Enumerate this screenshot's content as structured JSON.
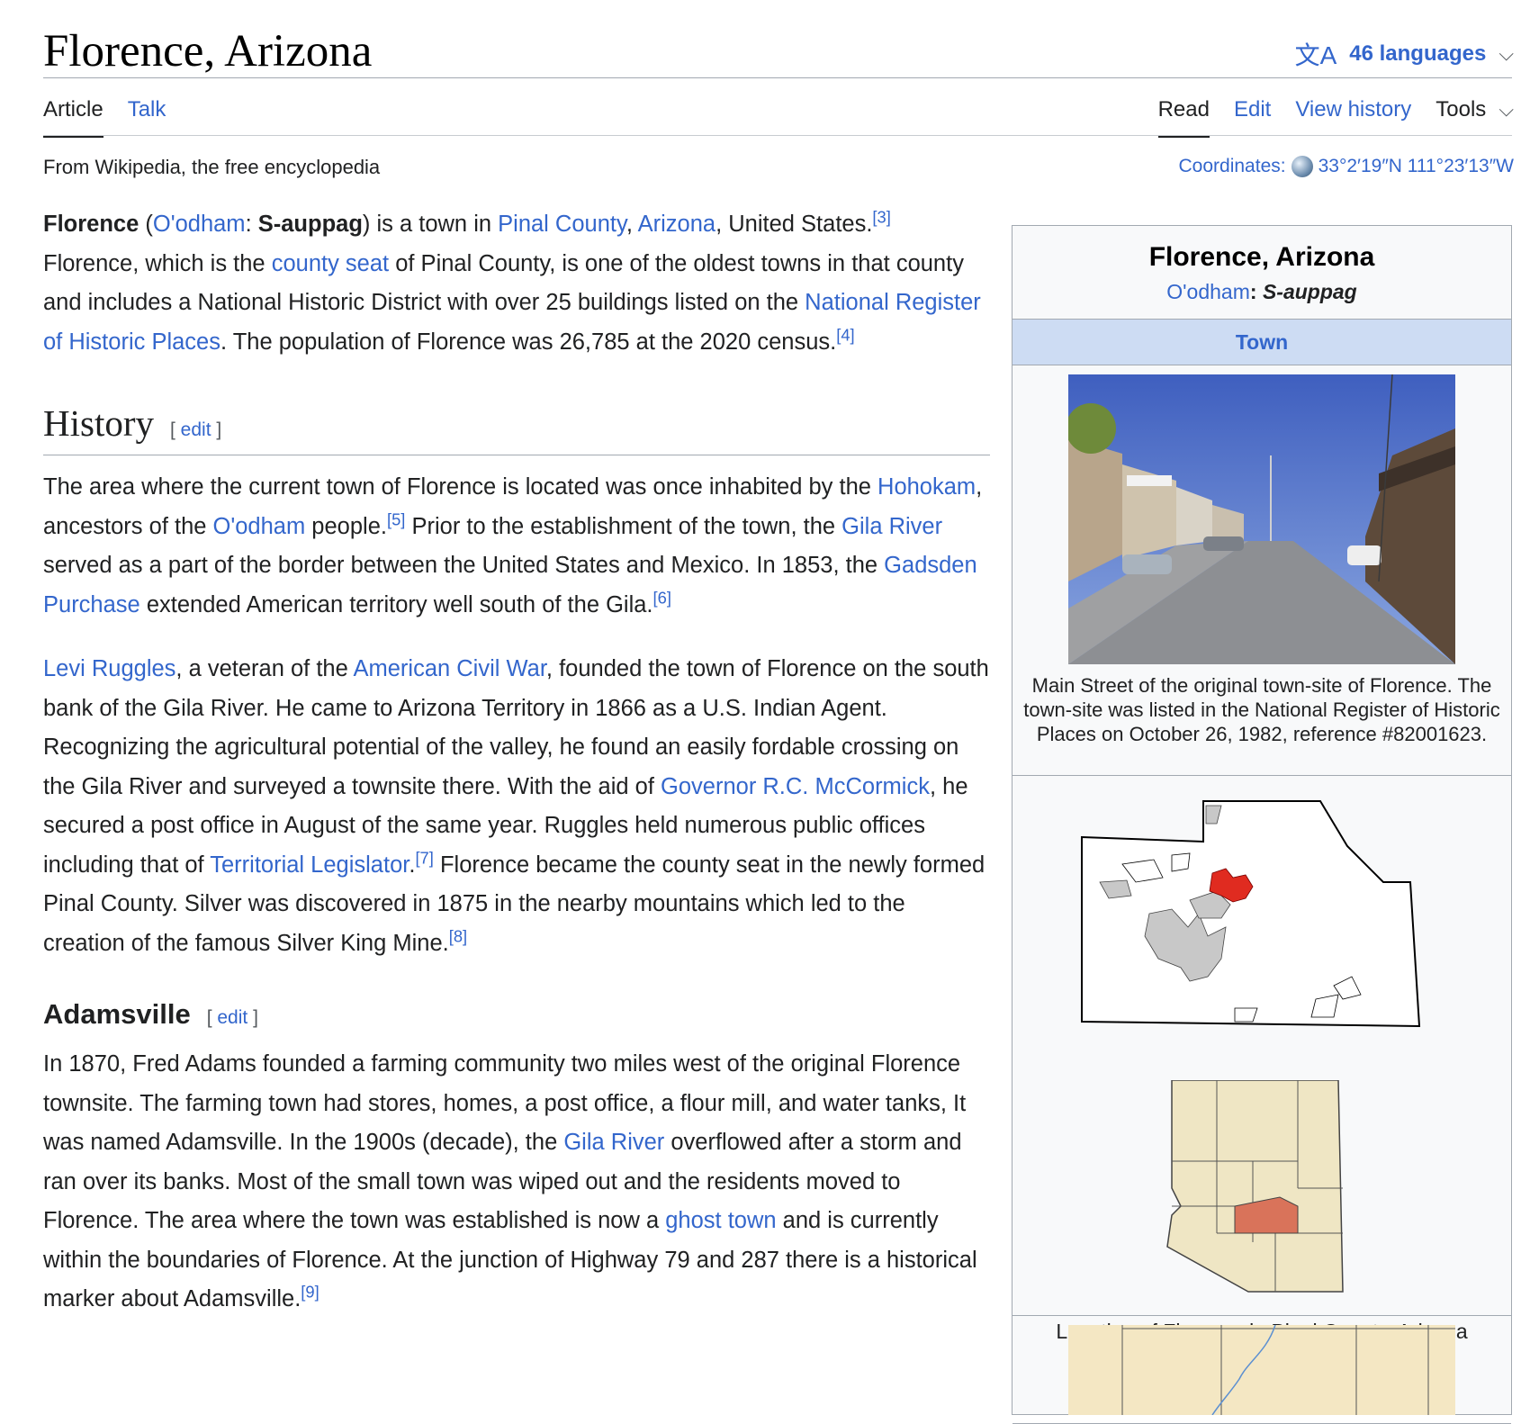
{
  "page": {
    "title": "Florence, Arizona",
    "languages_label": "46 languages",
    "tabs_left": [
      "Article",
      "Talk"
    ],
    "tabs_right": [
      "Read",
      "Edit",
      "View history",
      "Tools"
    ],
    "tagline": "From Wikipedia, the free encyclopedia",
    "coords_label": "Coordinates:",
    "coords_value": "33°2′19″N 111°23′13″W"
  },
  "intro": {
    "name": "Florence",
    "paren_open": " (",
    "oodham_link": "O'odham",
    "colon": ": ",
    "native_name": "S-auppag",
    "t1": ") is a town in ",
    "pinal_link": "Pinal County",
    "comma": ", ",
    "arizona_link": "Arizona",
    "t2": ", United States.",
    "ref3": "[3]",
    "t3": " Florence, which is the ",
    "county_seat_link": "county seat",
    "t4": " of Pinal County, is one of the oldest towns in that county and includes a National Historic District with over 25 buildings listed on the ",
    "nrhp_link": "National Register of Historic Places",
    "t5": ". The population of Florence was 26,785 at the 2020 census.",
    "ref4": "[4]"
  },
  "history": {
    "heading": "History",
    "edit": "[ edit ]",
    "p1": {
      "t1": "The area where the current town of Florence is located was once inhabited by the ",
      "hohokam": "Hohokam",
      "t2": ", ancestors of the ",
      "oodham": "O'odham",
      "t3": " people.",
      "ref5": "[5]",
      "t4": " Prior to the establishment of the town, the ",
      "gila": "Gila River",
      "t5": " served as a part of the border between the United States and Mexico. In 1853, the ",
      "gadsden": "Gadsden Purchase",
      "t6": " extended American territory well south of the Gila.",
      "ref6": "[6]"
    },
    "p2": {
      "levi": "Levi Ruggles",
      "t1": ", a veteran of the ",
      "acw": "American Civil War",
      "t2": ", founded the town of Florence on the south bank of the Gila River. He came to Arizona Territory in 1866 as a U.S. Indian Agent. Recognizing the agricultural potential of the valley, he found an easily fordable crossing on the Gila River and surveyed a townsite there. With the aid of ",
      "gov": "Governor R.C. McCormick",
      "t3": ", he secured a post office in August of the same year. Ruggles held numerous public offices including that of ",
      "terr": "Territorial Legislator",
      "t4": ".",
      "ref7": "[7]",
      "t5": " Florence became the county seat in the newly formed Pinal County. Silver was discovered in 1875 in the nearby mountains which led to the creation of the famous Silver King Mine.",
      "ref8": "[8]"
    }
  },
  "adamsville": {
    "heading": "Adamsville",
    "edit": "[ edit ]",
    "t1": "In 1870, Fred Adams founded a farming community two miles west of the original Florence townsite. The farming town had stores, homes, a post office, a flour mill, and water tanks, It was named Adamsville. In the 1900s (decade), the ",
    "gila": "Gila River",
    "t2": " overflowed after a storm and ran over its banks. Most of the small town was wiped out and the residents moved to Florence. The area where the town was established is now a ",
    "ghost": "ghost town",
    "t3": " and is currently within the boundaries of Florence. At the junction of Highway 79 and 287 there is a historical marker about Adamsville.",
    "ref9": "[9]"
  },
  "infobox": {
    "name": "Florence, Arizona",
    "native_link": "O'odham",
    "native_sep": ": ",
    "native_name": "S-auppag",
    "type": "Town",
    "photo_caption": "Main Street of the original town-site of Florence. The town-site was listed in the National Register of Historic Places on October 26, 1982, reference #82001623.",
    "map_caption": "Location of Florence in Pinal County, Arizona"
  },
  "colors": {
    "link": "#3366cc",
    "infobox_type_bg": "#cddcf3",
    "town_highlight": "#e02b20",
    "county_highlight": "#d9735a",
    "state_fill": "#efe6c4"
  },
  "icons": [
    "translate-icon",
    "chevron-down-icon",
    "globe-icon"
  ]
}
